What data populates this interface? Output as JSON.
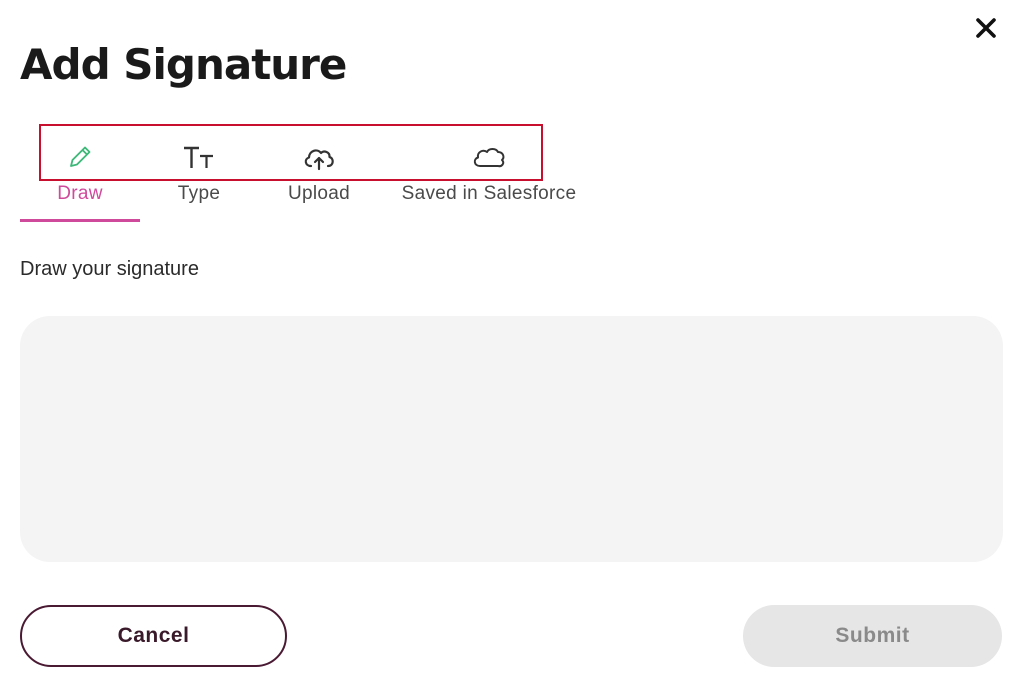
{
  "dialog": {
    "title": "Add Signature"
  },
  "tabs": [
    {
      "label": "Draw",
      "icon": "pencil-icon",
      "active": true
    },
    {
      "label": "Type",
      "icon": "text-size-icon",
      "active": false
    },
    {
      "label": "Upload",
      "icon": "cloud-upload-icon",
      "active": false
    },
    {
      "label": "Saved in Salesforce",
      "icon": "cloud-icon",
      "active": false
    }
  ],
  "instruction": "Draw your signature",
  "actions": {
    "cancel_label": "Cancel",
    "submit_label": "Submit"
  },
  "colors": {
    "accent": "#d04a9c",
    "pencil_icon": "#3cb878",
    "highlight_border": "#c8102e",
    "cancel_border": "#4a1a33",
    "canvas_bg": "#f4f4f4",
    "submit_disabled_bg": "#e6e6e6"
  }
}
